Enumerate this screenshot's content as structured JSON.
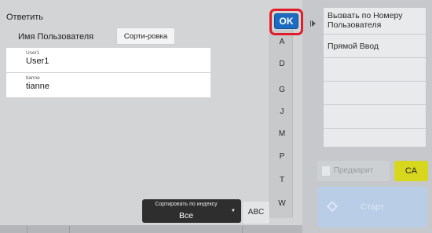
{
  "dialog": {
    "title": "Ответить",
    "user_header": {
      "name_label": "Имя Пользователя",
      "sort_label": "Сорти-ровка"
    },
    "users": [
      {
        "small": "User1",
        "name": "User1"
      },
      {
        "small": "tianne",
        "name": "tianne"
      }
    ],
    "index_letters": [
      "A",
      "D",
      "G",
      "J",
      "M",
      "P",
      "T",
      "W"
    ],
    "ok_label": "OK",
    "sort_index": {
      "label": "Сортировать по индексу",
      "value": "Все"
    },
    "abc_label": "ABC"
  },
  "background_panel": {
    "menu_items": [
      "Вызвать по Номеру Пользователя",
      "Прямой Ввод"
    ],
    "preview_label": "Предварит",
    "ca_label": "CA",
    "start_label": "Старт"
  },
  "colors": {
    "ok_button": "#1d6bc0",
    "highlight": "#e21c2a",
    "ca_button": "#d7d81d",
    "sort_index_bg": "#2e2e2e"
  }
}
